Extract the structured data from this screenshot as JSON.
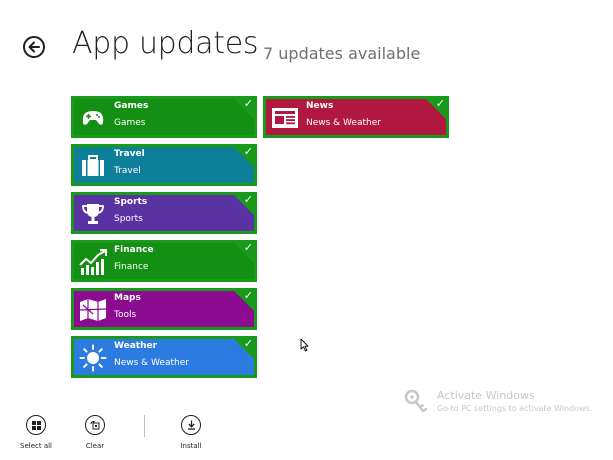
{
  "header": {
    "title": "App updates",
    "subtitle": "7 updates available"
  },
  "tiles": [
    {
      "name": "Games",
      "category": "Games",
      "color": "#138f13",
      "icon": "gamepad-icon",
      "selected": true
    },
    {
      "name": "Travel",
      "category": "Travel",
      "color": "#0d7f98",
      "icon": "suitcase-icon",
      "selected": true
    },
    {
      "name": "Sports",
      "category": "Sports",
      "color": "#5a33a3",
      "icon": "trophy-icon",
      "selected": true
    },
    {
      "name": "Finance",
      "category": "Finance",
      "color": "#138f13",
      "icon": "chart-icon",
      "selected": true
    },
    {
      "name": "Maps",
      "category": "Tools",
      "color": "#8b0c91",
      "icon": "map-icon",
      "selected": true
    },
    {
      "name": "Weather",
      "category": "News & Weather",
      "color": "#2c7be0",
      "icon": "sun-icon",
      "selected": true
    },
    {
      "name": "News",
      "category": "News & Weather",
      "color": "#b0183f",
      "icon": "newspaper-icon",
      "selected": true
    }
  ],
  "selection_color": "#1a9a1a",
  "check_glyph": "✓",
  "watermark": {
    "title": "Activate Windows",
    "subtitle": "Go to PC settings to activate Windows."
  },
  "appbar": {
    "select_all": "Select all",
    "clear": "Clear",
    "install": "Install"
  }
}
